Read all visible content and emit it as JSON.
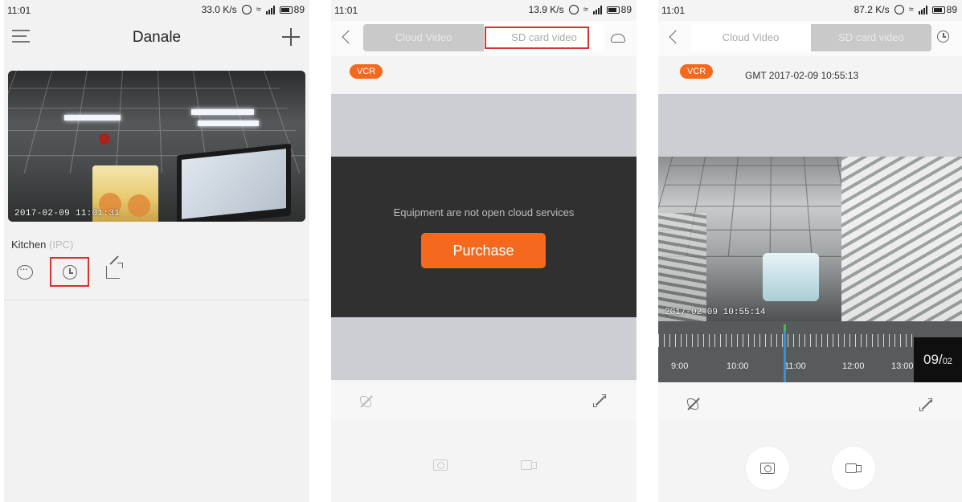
{
  "screen1": {
    "status": {
      "time": "11:01",
      "speed": "33.0 K/s",
      "battery": "89"
    },
    "nav": {
      "title": "Danale"
    },
    "camera": {
      "timestamp": "2017-02-09 11:01:31"
    },
    "device": {
      "name": "Kitchen",
      "type": "(IPC)"
    }
  },
  "screen2": {
    "status": {
      "time": "11:01",
      "speed": "13.9 K/s",
      "battery": "89"
    },
    "tabs": {
      "cloud": "Cloud Video",
      "sd": "SD card video"
    },
    "vcr": "VCR",
    "message": "Equipment are not open cloud services",
    "purchase": "Purchase"
  },
  "screen3": {
    "status": {
      "time": "11:01",
      "speed": "87.2 K/s",
      "battery": "89"
    },
    "tabs": {
      "cloud": "Cloud Video",
      "sd": "SD card video"
    },
    "vcr": "VCR",
    "gmt": "GMT  2017-02-09 10:55:13",
    "video_timestamp": "2017-02-09 10:55:14",
    "timeline": {
      "labels": [
        "9:00",
        "10:00",
        "11:00",
        "12:00",
        "13:00"
      ],
      "date_day": "09/",
      "date_month": "02"
    }
  },
  "colors": {
    "accent": "#f4691d",
    "highlight": "#d93030",
    "timeline_needle": "#3a8fd9"
  },
  "icons": [
    "menu-icon",
    "plus-icon",
    "message-icon",
    "history-clock-icon",
    "share-icon",
    "back-icon",
    "cloud-icon",
    "mute-icon",
    "fullscreen-icon",
    "snapshot-icon",
    "record-icon"
  ]
}
